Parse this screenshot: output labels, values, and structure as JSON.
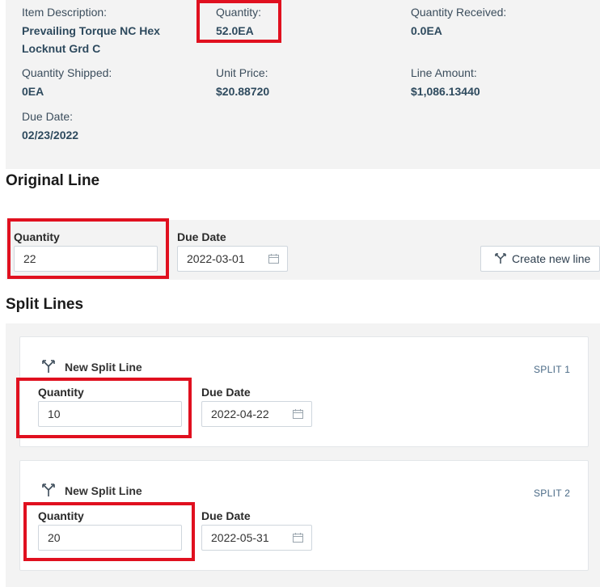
{
  "summary": {
    "item_description_label": "Item Description:",
    "item_description_line1": "Prevailing Torque NC Hex",
    "item_description_line2": "Locknut Grd C",
    "quantity_label": "Quantity:",
    "quantity_value": "52.0EA",
    "quantity_received_label": "Quantity Received:",
    "quantity_received_value": "0.0EA",
    "quantity_shipped_label": "Quantity Shipped:",
    "quantity_shipped_value": "0EA",
    "unit_price_label": "Unit Price:",
    "unit_price_value": "$20.88720",
    "line_amount_label": "Line Amount:",
    "line_amount_value": "$1,086.13440",
    "due_date_label": "Due Date:",
    "due_date_value": "02/23/2022"
  },
  "original_line": {
    "title": "Original Line",
    "quantity_label": "Quantity",
    "quantity_value": "22",
    "due_date_label": "Due Date",
    "due_date_value": "2022-03-01",
    "create_button_label": "Create new line"
  },
  "split_lines": {
    "title": "Split Lines",
    "cards": [
      {
        "title": "New Split Line",
        "badge": "SPLIT 1",
        "quantity_label": "Quantity",
        "quantity_value": "10",
        "due_date_label": "Due Date",
        "due_date_value": "2022-04-22"
      },
      {
        "title": "New Split Line",
        "badge": "SPLIT 2",
        "quantity_label": "Quantity",
        "quantity_value": "20",
        "due_date_label": "Due Date",
        "due_date_value": "2022-05-31"
      }
    ]
  },
  "icons": {
    "calendar": "calendar-icon",
    "split": "split-icon"
  },
  "colors": {
    "highlight": "#e0101f",
    "panel_bg": "#f3f3f3",
    "value_text": "#2e4a5e"
  }
}
